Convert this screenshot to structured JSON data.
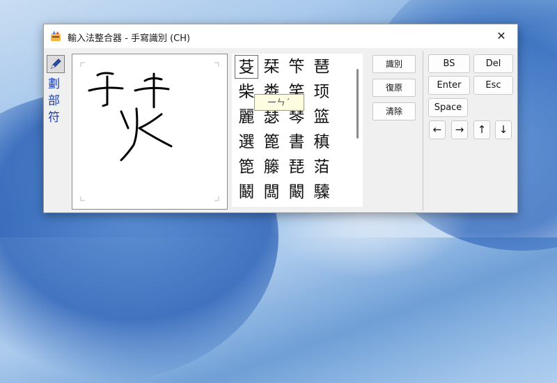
{
  "window": {
    "title": "輸入法整合器 - 手寫識別 (CH)",
    "close_glyph": "✕"
  },
  "toolbar": {
    "labels": [
      "劃",
      "部",
      "符"
    ]
  },
  "candidates": [
    "芟",
    "栞",
    "笇",
    "琶",
    "柴",
    "粦",
    "笑",
    "顼",
    "麗",
    "瑟",
    "琴",
    "篮",
    "選",
    "篦",
    "書",
    "稹",
    "箆",
    "籐",
    "琵",
    "萡",
    "鬫",
    "闆",
    "闞",
    "驝"
  ],
  "tooltip": "一ㄣˊ",
  "actions": {
    "recognize": "識別",
    "restore": "復原",
    "clear": "清除"
  },
  "keys": {
    "bs": "BS",
    "del": "Del",
    "enter": "Enter",
    "esc": "Esc",
    "space": "Space",
    "left": "←",
    "right": "→",
    "up": "↑",
    "down": "↓"
  }
}
